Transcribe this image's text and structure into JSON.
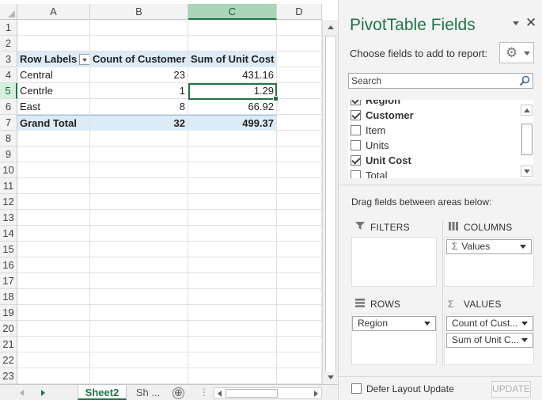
{
  "spreadsheet": {
    "columns": [
      "A",
      "B",
      "C",
      "D"
    ],
    "selected_column": "C",
    "row_numbers": [
      "1",
      "2",
      "3",
      "4",
      "5",
      "6",
      "7",
      "8",
      "9",
      "10",
      "11",
      "12",
      "13",
      "14",
      "15",
      "16",
      "17",
      "18",
      "19",
      "20",
      "21",
      "22",
      "23"
    ],
    "selected_row": "5",
    "pivot": {
      "headers": [
        "Row Labels",
        "Count of Customer",
        "Sum of Unit Cost"
      ],
      "rows": [
        {
          "label": "Central",
          "count": "23",
          "sum": "431.16"
        },
        {
          "label": "Centrle",
          "count": "1",
          "sum": "1.29"
        },
        {
          "label": "East",
          "count": "8",
          "sum": "66.92"
        }
      ],
      "grand_total": {
        "label": "Grand Total",
        "count": "32",
        "sum": "499.37"
      }
    },
    "sheet_tabs": {
      "active": "Sheet2",
      "other": "Sh ..."
    },
    "add_sheet_symbol": "⊕"
  },
  "pivot_panel": {
    "title": "PivotTable Fields",
    "choose_label": "Choose fields to add to report:",
    "search_placeholder": "Search",
    "fields": [
      {
        "name": "Region",
        "checked": true
      },
      {
        "name": "Customer",
        "checked": true
      },
      {
        "name": "Item",
        "checked": false
      },
      {
        "name": "Units",
        "checked": false
      },
      {
        "name": "Unit Cost",
        "checked": true
      },
      {
        "name": "Total",
        "checked": false
      }
    ],
    "drag_label": "Drag fields between areas below:",
    "areas": {
      "filters": {
        "label": "FILTERS",
        "items": []
      },
      "columns": {
        "label": "COLUMNS",
        "items": [
          "Values"
        ]
      },
      "rows": {
        "label": "ROWS",
        "items": [
          "Region"
        ]
      },
      "values": {
        "label": "VALUES",
        "items": [
          "Count of Cust...",
          "Sum of Unit C..."
        ]
      }
    },
    "defer_label": "Defer Layout Update",
    "update_label": "UPDATE"
  }
}
